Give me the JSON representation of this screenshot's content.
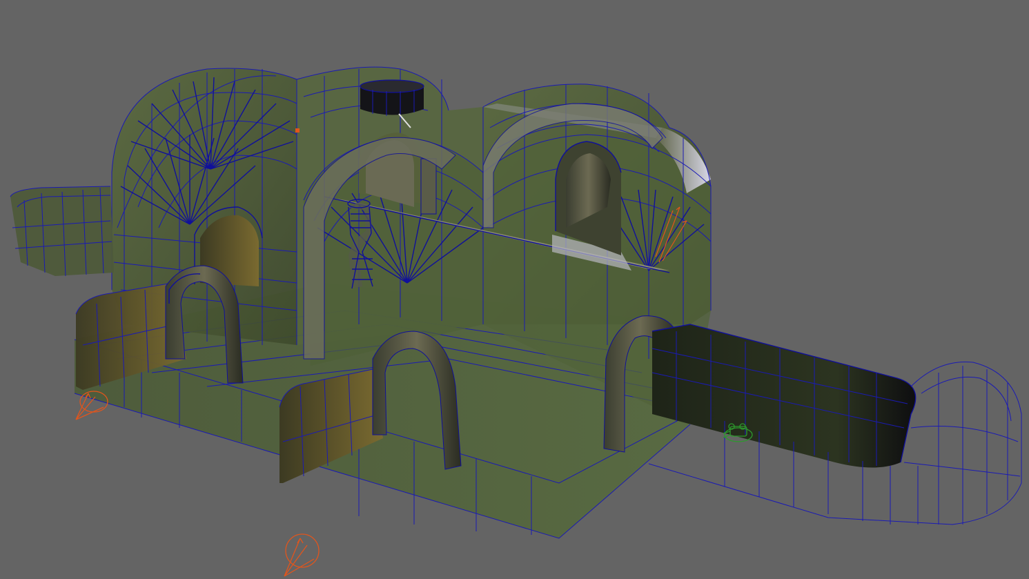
{
  "viewport": {
    "background": "#646464",
    "wireframe_color": "#1a1ab4",
    "shaded_color": "#4c5a38",
    "light_color": "#e2551c",
    "camera_icon_color": "#2c9a2c",
    "shading_mode": "wireframe-on-shaded"
  },
  "scene_objects": [
    {
      "name": "main-hall",
      "icon": "building-mesh"
    },
    {
      "name": "left-tunnel",
      "icon": "vault-mesh"
    },
    {
      "name": "right-corridor",
      "icon": "corridor-mesh"
    },
    {
      "name": "spiral-stair",
      "icon": "stair-mesh"
    },
    {
      "name": "roof-chimney",
      "icon": "cylinder-mesh"
    },
    {
      "name": "spot-light-1",
      "icon": "spot-light-icon"
    },
    {
      "name": "spot-light-2",
      "icon": "spot-light-icon"
    },
    {
      "name": "spot-light-3",
      "icon": "spot-light-icon"
    },
    {
      "name": "camera-1",
      "icon": "camera-icon"
    }
  ]
}
